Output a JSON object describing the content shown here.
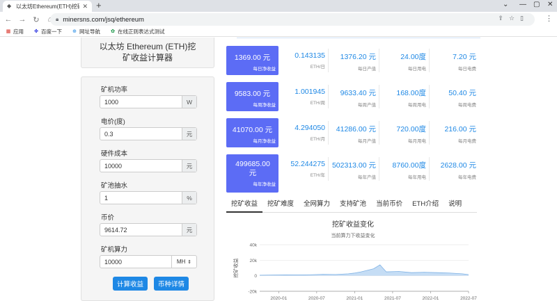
{
  "browser": {
    "tab_title": "以太坊Ethereum(ETH)挖矿收益",
    "url": "minersns.com/jsq/ethereum",
    "bookmarks": [
      "应用",
      "百度一下",
      "网址导航",
      "在线正则表达式测试"
    ]
  },
  "sidebar": {
    "title": "以太坊 Ethereum (ETH)挖矿收益计算器",
    "fields": [
      {
        "label": "矿机功率",
        "value": "1000",
        "unit": "W"
      },
      {
        "label": "电价(度)",
        "value": "0.3",
        "unit": "元"
      },
      {
        "label": "硬件成本",
        "value": "10000",
        "unit": "元"
      },
      {
        "label": "矿池抽水",
        "value": "1",
        "unit": "%"
      },
      {
        "label": "币价",
        "value": "9614.72",
        "unit": "元"
      },
      {
        "label": "矿机算力",
        "value": "10000",
        "unit": "MH"
      }
    ],
    "calc_button": "计算收益",
    "detail_button": "币种详情"
  },
  "stats": [
    {
      "net": "1369.00 元",
      "net_label": "每日净收益",
      "coin": "0.143135",
      "coin_label": "ETH/日",
      "output": "1376.20 元",
      "output_label": "每日产值",
      "power": "24.00度",
      "power_label": "每日用电",
      "fee": "7.20 元",
      "fee_label": "每日电费"
    },
    {
      "net": "9583.00 元",
      "net_label": "每周净收益",
      "coin": "1.001945",
      "coin_label": "ETH/周",
      "output": "9633.40 元",
      "output_label": "每周产值",
      "power": "168.00度",
      "power_label": "每周用电",
      "fee": "50.40 元",
      "fee_label": "每周电费"
    },
    {
      "net": "41070.00 元",
      "net_label": "每月净收益",
      "coin": "4.294050",
      "coin_label": "ETH/月",
      "output": "41286.00 元",
      "output_label": "每月产值",
      "power": "720.00度",
      "power_label": "每月用电",
      "fee": "216.00 元",
      "fee_label": "每月电费"
    },
    {
      "net": "499685.00 元",
      "net_label": "每年净收益",
      "coin": "52.244275",
      "coin_label": "ETH/年",
      "output": "502313.00 元",
      "output_label": "每年产值",
      "power": "8760.00度",
      "power_label": "每年用电",
      "fee": "2628.00 元",
      "fee_label": "每年电费"
    }
  ],
  "tabs": [
    "挖矿收益",
    "挖矿难度",
    "全网算力",
    "支持矿池",
    "当前币价",
    "ETH介绍",
    "说明"
  ],
  "colors": {
    "accent": "#1e88e5",
    "stat_box": "#5c6cf5",
    "chart_fill": "#c5ddf5",
    "chart_line": "#7fb2e5"
  },
  "chart_data": {
    "type": "area",
    "title": "挖矿收益变化",
    "subtitle": "当前算力下收益变化",
    "ylabel": "挖矿收益",
    "ylim": [
      -20000,
      40000
    ],
    "yticks": [
      "-20k",
      "0",
      "20k",
      "40k"
    ],
    "xticks": [
      "2020-01",
      "2020-07",
      "2021-01",
      "2021-07",
      "2022-01",
      "2022-07"
    ],
    "x": [
      "2019-10",
      "2019-12",
      "2020-02",
      "2020-04",
      "2020-06",
      "2020-08",
      "2020-10",
      "2020-12",
      "2021-01",
      "2021-02",
      "2021-03",
      "2021-04",
      "2021-05",
      "2021-06",
      "2021-08",
      "2021-10",
      "2021-12",
      "2022-02",
      "2022-04",
      "2022-06",
      "2022-07"
    ],
    "values": [
      700,
      900,
      1100,
      1000,
      1300,
      1800,
      1600,
      2500,
      3500,
      5000,
      7000,
      9000,
      14000,
      5000,
      5500,
      4000,
      4500,
      4000,
      3500,
      2500,
      1500
    ]
  }
}
